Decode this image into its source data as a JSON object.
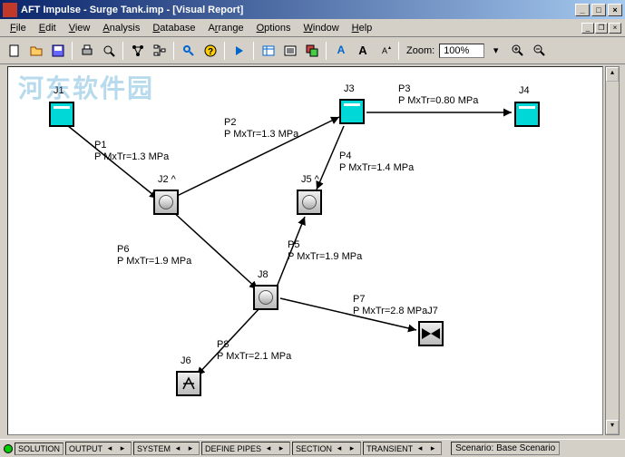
{
  "window": {
    "title": "AFT Impulse - Surge Tank.imp - [Visual Report]",
    "min": "_",
    "max": "□",
    "close": "×"
  },
  "menu": {
    "file": "File",
    "edit": "Edit",
    "view": "View",
    "analysis": "Analysis",
    "database": "Database",
    "arrange": "Arrange",
    "options": "Options",
    "window": "Window",
    "help": "Help"
  },
  "toolbar": {
    "zoom_label": "Zoom:",
    "zoom_value": "100%"
  },
  "nodes": {
    "J1": "J1",
    "J2": "J2 ^",
    "J3": "J3",
    "J4": "J4",
    "J5": "J5 ^",
    "J6": "J6",
    "J7": "J7",
    "J8": "J8"
  },
  "pipes": {
    "P1": {
      "name": "P1",
      "val": "P MxTr=1.3 MPa"
    },
    "P2": {
      "name": "P2",
      "val": "P MxTr=1.3 MPa"
    },
    "P3": {
      "name": "P3",
      "val": "P MxTr=0.80 MPa"
    },
    "P4": {
      "name": "P4",
      "val": "P MxTr=1.4 MPa"
    },
    "P5": {
      "name": "P5",
      "val": "P MxTr=1.9 MPa"
    },
    "P6": {
      "name": "P6",
      "val": "P MxTr=1.9 MPa"
    },
    "P7": {
      "name": "P7",
      "val": "P MxTr=2.8 MPa"
    },
    "P8": {
      "name": "P8",
      "val": "P MxTr=2.1 MPa"
    }
  },
  "status": {
    "solution": "SOLUTION",
    "output": "OUTPUT",
    "system": "SYSTEM",
    "definepipes": "DEFINE PIPES",
    "section": "SECTION",
    "transient": "TRANSIENT",
    "scenario_label": "Scenario:",
    "scenario_value": "Base Scenario"
  },
  "watermark": "河东软件园"
}
